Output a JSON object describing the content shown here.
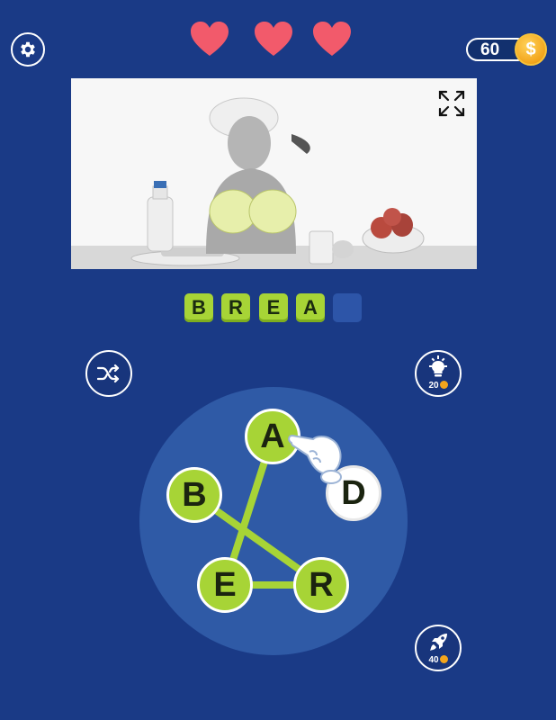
{
  "lives": {
    "count": 3,
    "color": "#f25a6b"
  },
  "coins": {
    "amount": "60",
    "symbol": "$"
  },
  "answer": {
    "letters": [
      "B",
      "R",
      "E",
      "A",
      ""
    ],
    "length": 5
  },
  "wheel": {
    "letters": [
      "A",
      "B",
      "D",
      "E",
      "R"
    ],
    "selected": [
      "B",
      "R",
      "E",
      "A"
    ]
  },
  "hint": {
    "cost": "20"
  },
  "boost": {
    "cost": "40"
  },
  "colors": {
    "background": "#1a3a86",
    "tile": "#a7d436",
    "wheel": "#2f5aa6",
    "coin": "#f3a51c"
  }
}
